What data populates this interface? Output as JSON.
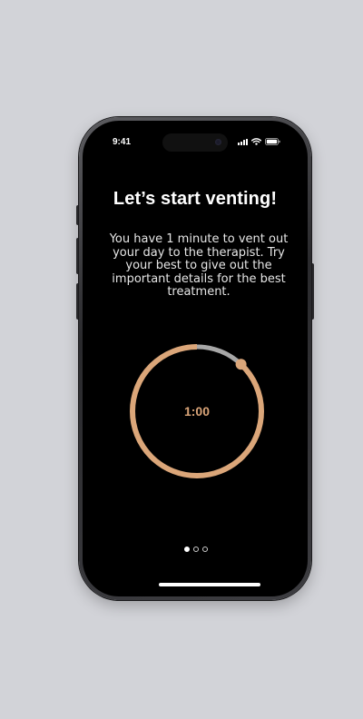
{
  "status_bar": {
    "time": "9:41",
    "icons": [
      "signal-icon",
      "wifi-icon",
      "battery-icon"
    ]
  },
  "screen": {
    "title": "Let’s start venting!",
    "description": "You have 1 minute to vent out your day to the therapist. Try your best to give out the important details for the best treatment."
  },
  "timer": {
    "label": "1:00",
    "progress": 0.88,
    "colors": {
      "progress": "#dba679",
      "track": "#a7a7a7",
      "label": "#d9a478"
    }
  },
  "pager": {
    "total": 3,
    "active_index": 0
  },
  "colors": {
    "background": "#d2d3d8",
    "screen": "#000000",
    "accent": "#dba679"
  }
}
